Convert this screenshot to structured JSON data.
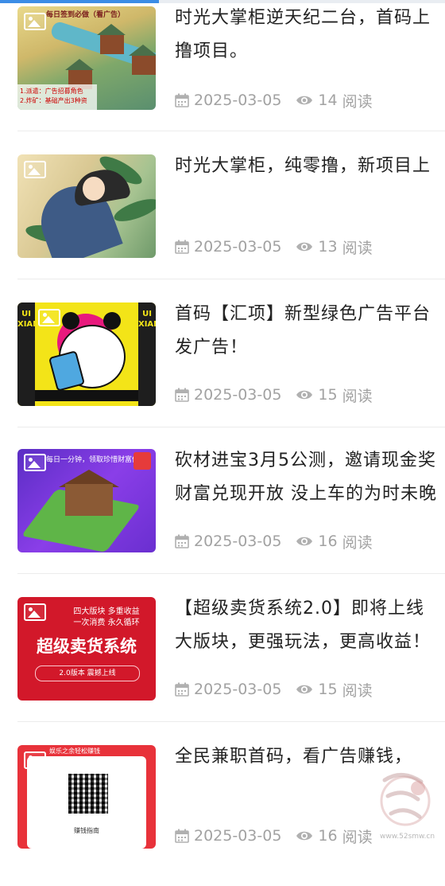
{
  "articles": [
    {
      "title_line1": "时光大掌柜逆天纪二台，首码上",
      "title_line2": "撸项目。",
      "date": "2025-03-05",
      "views": "14",
      "views_suffix": "阅读",
      "thumb_top_text": "每日签到必做（看广告）",
      "thumb_caption_1": "1.派遣：广告招募角色",
      "thumb_caption_2": "2.炸矿：基础产出3种资"
    },
    {
      "title_line1": "时光大掌柜，纯零撸，新项目上",
      "title_line2": "",
      "date": "2025-03-05",
      "views": "13",
      "views_suffix": "阅读"
    },
    {
      "title_line1": "首码【汇项】新型绿色广告平台",
      "title_line2": "发广告！",
      "date": "2025-03-05",
      "views": "15",
      "views_suffix": "阅读",
      "thumb_side_text": "UI XIANG"
    },
    {
      "title_line1": "砍材进宝3月5公测，邀请现金奖",
      "title_line2": "财富兑现开放 没上车的为时未晚",
      "date": "2025-03-05",
      "views": "16",
      "views_suffix": "阅读",
      "thumb_banner": "每日一分钟，领取珍惜财富值"
    },
    {
      "title_line1": "【超级卖货系统2.0】即将上线",
      "title_line2": "大版块，更强玩法，更高收益！",
      "date": "2025-03-05",
      "views": "15",
      "views_suffix": "阅读",
      "thumb_line1": "四大版块 多重收益",
      "thumb_line2": "一次消费 永久循环",
      "thumb_big": "超级卖货系统",
      "thumb_pill": "2.0版本 震撼上线"
    },
    {
      "title_line1": "全民兼职首码，看广告赚钱，",
      "title_line2": "",
      "date": "2025-03-05",
      "views": "16",
      "views_suffix": "阅读",
      "thumb_top": "娱乐之余轻松赚钱",
      "thumb_guide": "赚钱指南"
    }
  ],
  "watermark": {
    "text": "www.52smw.cn",
    "logo_chars": "首码"
  },
  "colors": {
    "accent": "#3c8de6",
    "meta_gray": "#a2a2a2",
    "divider": "#ececec"
  },
  "icons": {
    "date": "calendar-icon",
    "views": "eye-icon",
    "thumb": "image-placeholder-icon"
  }
}
